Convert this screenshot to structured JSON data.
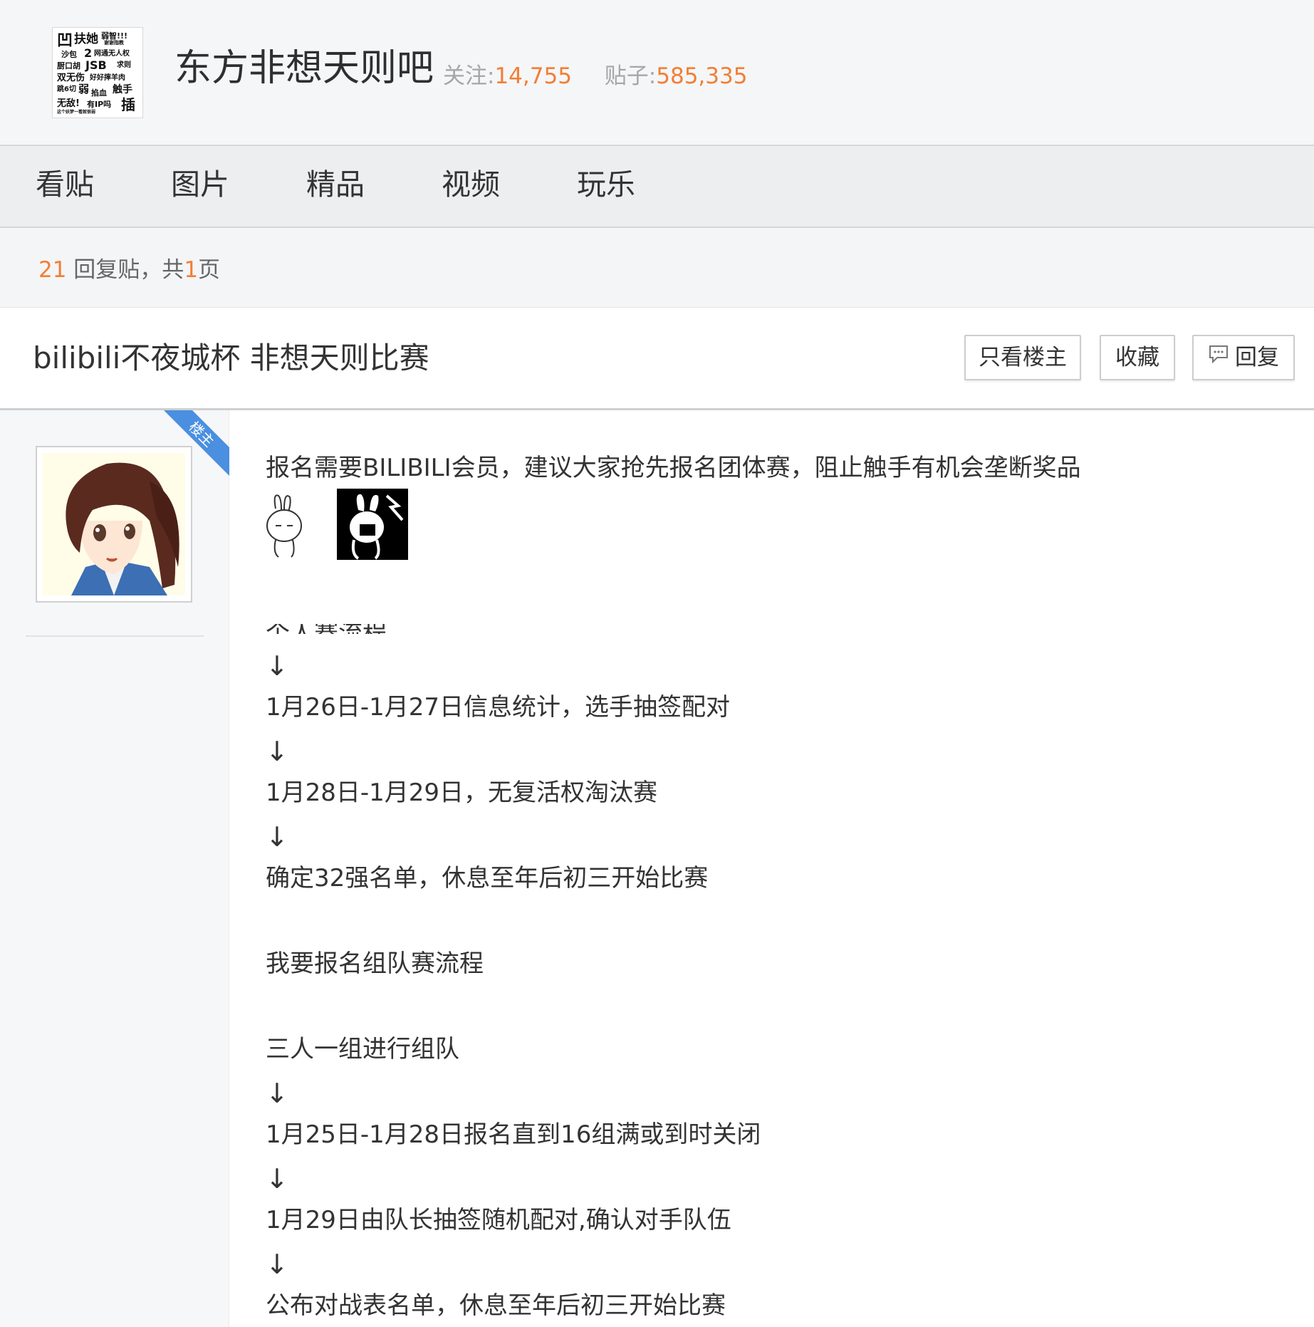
{
  "forum": {
    "name": "东方非想天则吧",
    "follow_label": "关注:",
    "follow_count": "14,755",
    "posts_label": "贴子:",
    "posts_count": "585,335",
    "logo_words": [
      "凹",
      "扶她",
      "弱智!!!",
      "谢谢指教",
      "沙包",
      "2",
      "网通无人权",
      "厨口胡",
      "JSB",
      "求则",
      "双无伤",
      "好好摔羊肉",
      "跳6切",
      "弱",
      "掐血",
      "触手",
      "无敌!",
      "有IP吗",
      "插",
      "这个妖梦一看就很弱"
    ]
  },
  "nav": {
    "tabs": [
      "看贴",
      "图片",
      "精品",
      "视频",
      "玩乐"
    ]
  },
  "reply_info": {
    "count": "21",
    "label": " 回复贴，共",
    "pages": "1",
    "pages_suffix": "页"
  },
  "thread": {
    "title": "bilibili不夜城杯 非想天则比赛",
    "buttons": {
      "only_op": "只看楼主",
      "favorite": "收藏",
      "reply": "回复"
    }
  },
  "post": {
    "op_badge": "楼主",
    "arrow": "↓",
    "lines": {
      "intro": "报名需要BILIBILI会员，建议大家抢先报名团体赛，阻止触手有机会垄断奖品",
      "cut": "个人赛流程",
      "l1": "1月26日-1月27日信息统计，选手抽签配对",
      "l2": "1月28日-1月29日，无复活权淘汰赛",
      "l3": "确定32强名单，休息至年后初三开始比赛",
      "l4": "我要报名组队赛流程",
      "l5": "三人一组进行组队",
      "l6": "1月25日-1月28日报名直到16组满或到时关闭",
      "l7": "1月29日由队长抽签随机配对,确认对手队伍",
      "l8": "公布对战表名单，休息至年后初三开始比赛"
    }
  },
  "colors": {
    "accent_orange": "#f27e34",
    "op_ribbon_blue": "#4a8fe0"
  }
}
